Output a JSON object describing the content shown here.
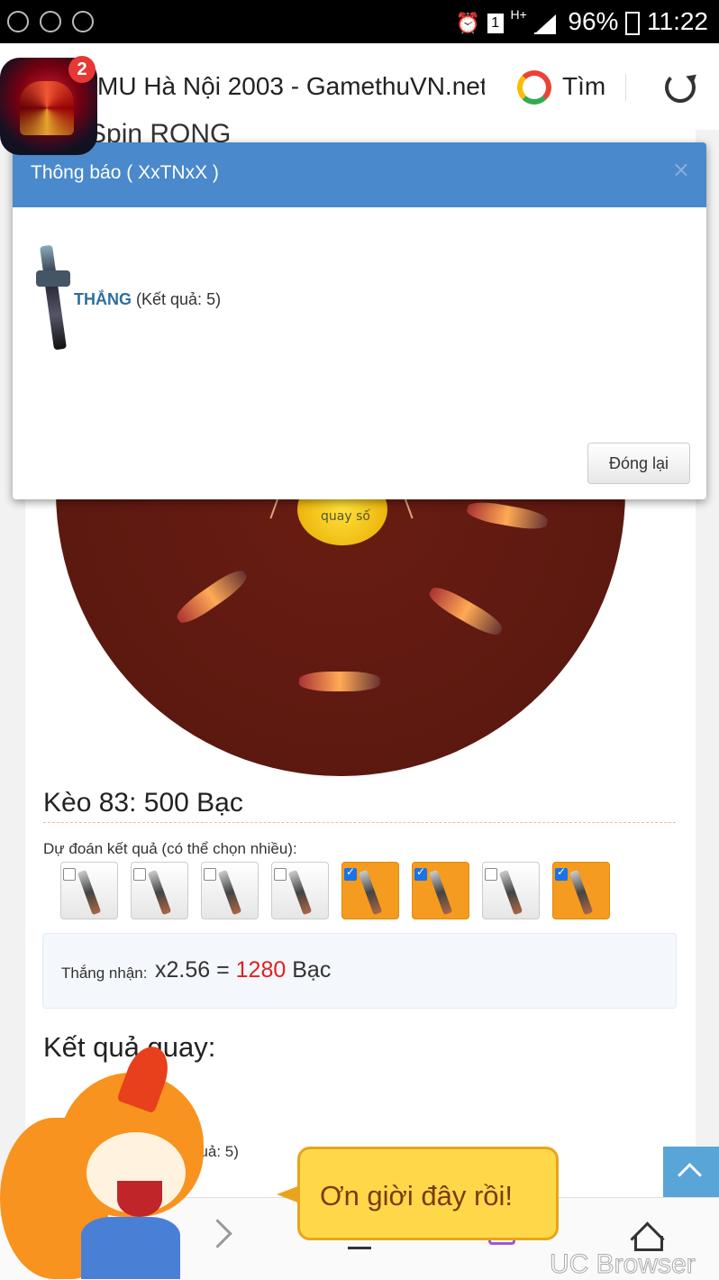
{
  "status_bar": {
    "battery": "96%",
    "time": "11:22",
    "network": "H+"
  },
  "browser": {
    "page_title": "MU Hà Nội 2003 - GamethuVN.net",
    "search_label": "Tìm",
    "notification_count": "2",
    "brand": "UC Browser"
  },
  "page": {
    "heading_peek": "Spin RONG",
    "spin_label": "quay số",
    "bet_title": "Kèo 83: 500 Bạc",
    "predict_label": "Dự đoán kết quả (có thể chọn nhiều):",
    "items": [
      {
        "name": "item-1",
        "selected": false
      },
      {
        "name": "item-2",
        "selected": false
      },
      {
        "name": "item-3",
        "selected": false
      },
      {
        "name": "item-4",
        "selected": false
      },
      {
        "name": "item-5",
        "selected": true
      },
      {
        "name": "item-6",
        "selected": true
      },
      {
        "name": "item-7",
        "selected": false
      },
      {
        "name": "item-8",
        "selected": true
      }
    ],
    "win_label": "Thắng nhận:",
    "win_multiplier": "x2.56 =",
    "win_amount": "1280",
    "win_currency": "Bạc",
    "result_title": "Kết quả quay:",
    "result_peek": "quả: 5)"
  },
  "modal": {
    "title": "Thông báo ( XxTNxX )",
    "close": "×",
    "result_word": "THẮNG",
    "result_detail": "(Kết quả: 5)",
    "close_button": "Đóng lại"
  },
  "mascot": {
    "speech": "Ơn giời đây rồi!"
  },
  "colors": {
    "modal_header": "#4a89cb",
    "selected_item": "#f59b1f",
    "win_amount": "#e02020",
    "bubble": "#ffd84a"
  }
}
